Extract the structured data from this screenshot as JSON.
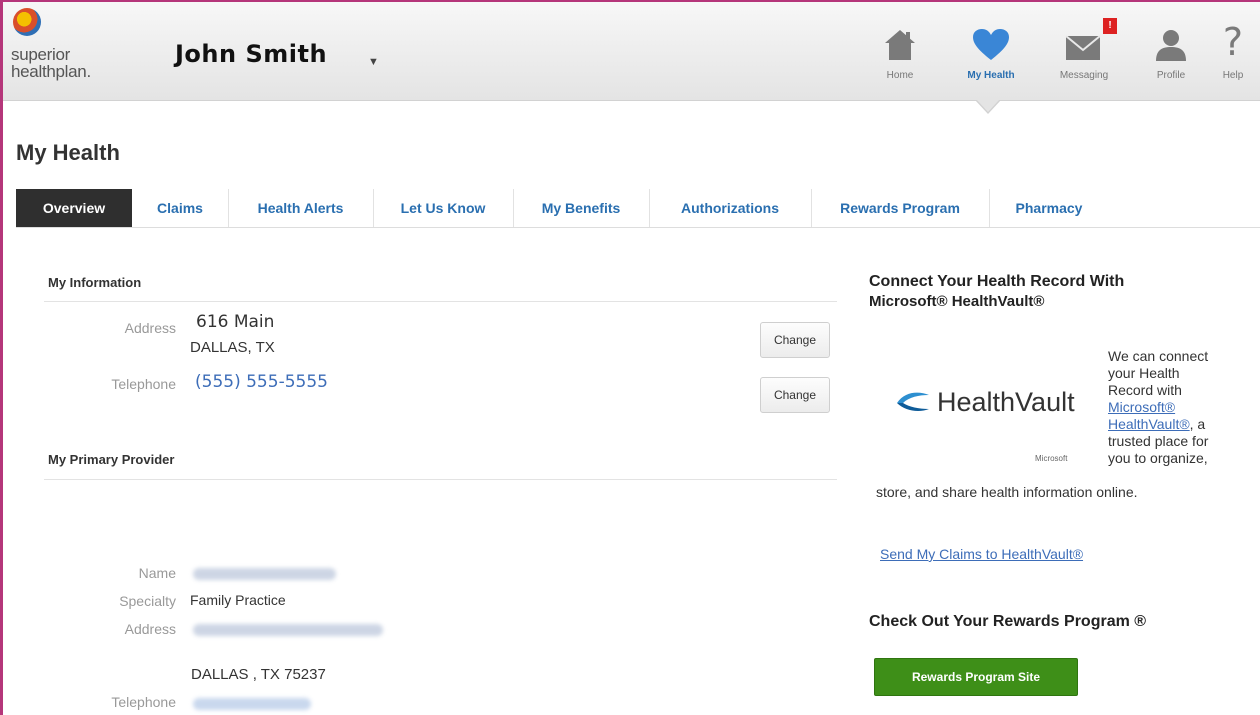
{
  "header": {
    "logo_line1": "superior",
    "logo_line2": "healthplan.",
    "user_name": "John Smith",
    "nav": [
      {
        "label": "Home",
        "icon": "home-icon",
        "active": false
      },
      {
        "label": "My Health",
        "icon": "heart-icon",
        "active": true
      },
      {
        "label": "Messaging",
        "icon": "envelope-icon",
        "active": false,
        "badge": "!"
      },
      {
        "label": "Profile",
        "icon": "user-icon",
        "active": false
      },
      {
        "label": "Help",
        "icon": "question-icon",
        "active": false
      }
    ]
  },
  "page": {
    "title": "My Health",
    "tabs": [
      "Overview",
      "Claims",
      "Health Alerts",
      "Let Us Know",
      "My Benefits",
      "Authorizations",
      "Rewards Program",
      "Pharmacy"
    ]
  },
  "my_information": {
    "heading": "My Information",
    "address_label": "Address",
    "address_line1": "616 Main",
    "address_line2": "DALLAS, TX",
    "telephone_label": "Telephone",
    "telephone_value": "(555) 555-5555",
    "change_label": "Change"
  },
  "primary_provider": {
    "heading": "My Primary Provider",
    "name_label": "Name",
    "specialty_label": "Specialty",
    "specialty_value": "Family Practice",
    "address_label": "Address",
    "city_line": "DALLAS , TX 75237",
    "telephone_label": "Telephone"
  },
  "healthvault": {
    "heading_line1": "Connect Your Health Record With",
    "heading_line2": "Microsoft® HealthVault®",
    "logo_word": "HealthVault",
    "logo_sub": "Microsoft",
    "text_1": "We can connect",
    "text_2": "your Health",
    "text_3": "Record with",
    "link_1": "Microsoft®",
    "link_2": "HealthVault®",
    "text_4": ", a",
    "text_5": "trusted place for",
    "text_6": "you to organize,",
    "text_7": "store, and share health information online.",
    "send_link": "Send My Claims to HealthVault®"
  },
  "rewards": {
    "heading": "Check Out Your Rewards Program ®",
    "button_label": "Rewards Program Site"
  },
  "colors": {
    "accent_blue": "#2a6fb0",
    "active_tab_bg": "#2f2f2f",
    "rewards_green": "#3e8f18",
    "frame_magenta": "#b5367a"
  }
}
